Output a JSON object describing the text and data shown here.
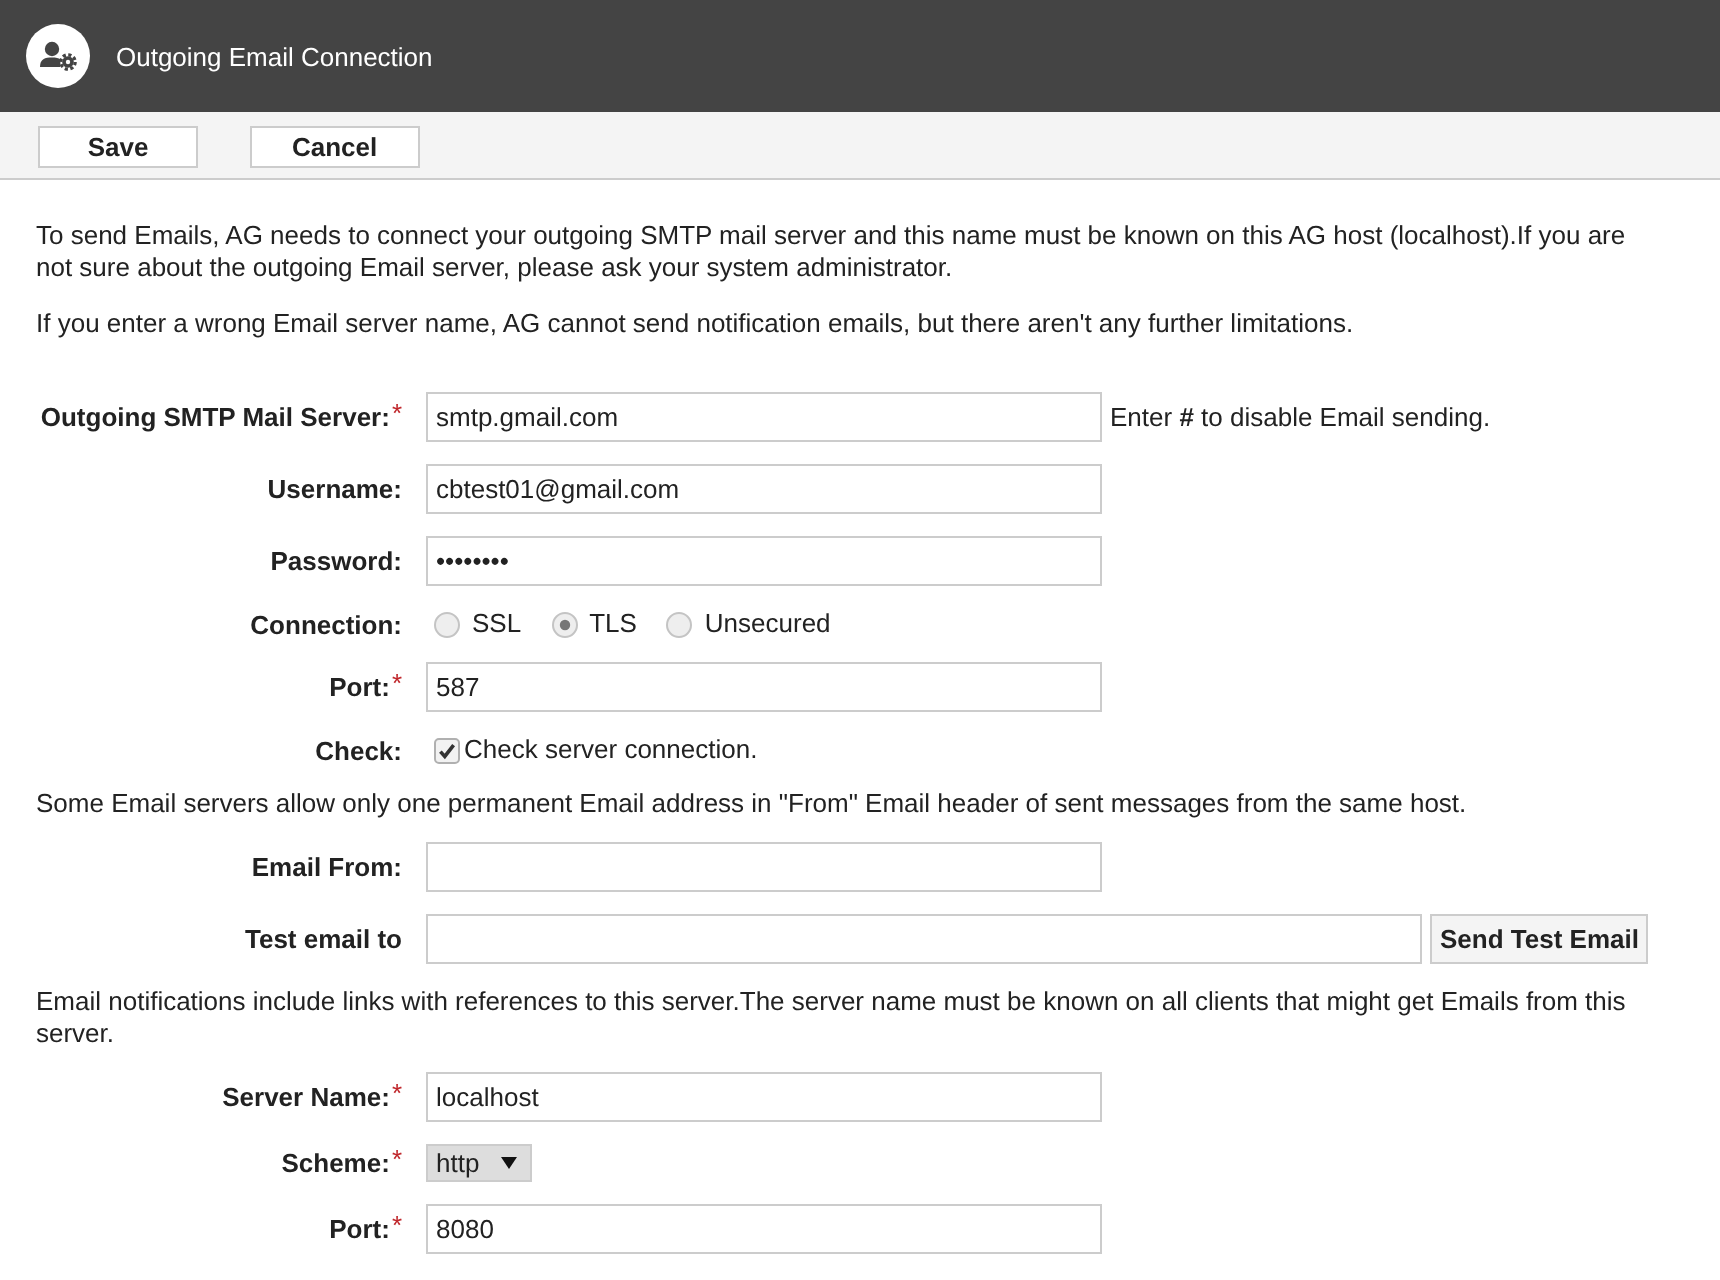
{
  "header": {
    "title": "Outgoing Email Connection"
  },
  "toolbar": {
    "buttons": [
      "Save",
      "Cancel"
    ]
  },
  "intro": [
    "To send Emails, AG needs to connect your outgoing SMTP mail server and this name must be known on this AG host (localhost).If you are not sure about the outgoing Email server, please ask your system administrator.",
    "If you enter a wrong Email server name, AG cannot send notification emails, but there aren't any further limitations."
  ],
  "form": [
    {
      "kind": "input",
      "label": "Outgoing SMTP Mail Server:",
      "required_mark": "*",
      "value": "smtp.gmail.com",
      "hint": "Enter **#** to disable Email sending."
    },
    {
      "kind": "input",
      "label": "Username:",
      "value": "cbtest01@gmail.com"
    },
    {
      "kind": "input",
      "label": "Password:",
      "value": "••••••••"
    },
    {
      "kind": "radio",
      "label": "Connection:",
      "options": [
        {
          "label": "SSL",
          "selected": false
        },
        {
          "label": "TLS",
          "selected": true
        },
        {
          "label": "Unsecured",
          "selected": false
        }
      ]
    },
    {
      "kind": "input",
      "label": "Port:",
      "required_mark": "*",
      "value": "587"
    },
    {
      "kind": "checkbox",
      "label": "Check:",
      "checked": true,
      "text": "Check server connection."
    },
    {
      "kind": "note",
      "text": "Some Email servers allow only one permanent Email address in \"From\" Email header of sent messages from the same host."
    },
    {
      "kind": "input",
      "label": "Email From:"
    },
    {
      "kind": "input",
      "label": "Test email to",
      "button": "Send Test Email"
    },
    {
      "kind": "note",
      "text": "Email notifications include links with references to this server.The server name must be known on all clients that might get Emails from this server."
    },
    {
      "kind": "input",
      "label": "Server Name:",
      "required_mark": "*",
      "value": "localhost"
    },
    {
      "kind": "select",
      "label": "Scheme:",
      "required_mark": "*",
      "value": "http"
    },
    {
      "kind": "input",
      "label": "Port:",
      "required_mark": "*",
      "value": "8080"
    }
  ]
}
